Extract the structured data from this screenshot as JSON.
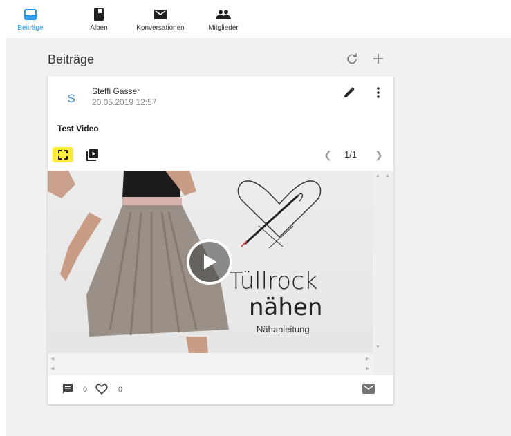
{
  "nav": {
    "items": [
      {
        "label": "Beiträge",
        "icon": "inbox-icon",
        "active": true
      },
      {
        "label": "Alben",
        "icon": "album-icon",
        "active": false
      },
      {
        "label": "Konversationen",
        "icon": "mail-icon",
        "active": false
      },
      {
        "label": "Mitglieder",
        "icon": "people-icon",
        "active": false
      }
    ]
  },
  "section": {
    "title": "Beiträge"
  },
  "post": {
    "avatar_letter": "S",
    "author": "Steffi Gasser",
    "date": "20.05.2019 12:57",
    "title": "Test Video",
    "pager": "1/1",
    "video": {
      "brand_line1": "Tüllrock",
      "brand_line2": "nähen",
      "brand_line3": "Nähanleitung"
    },
    "comments": "0",
    "likes": "0"
  },
  "colors": {
    "accent": "#2196f3",
    "highlight": "#ffeb3b",
    "icon": "#424242"
  }
}
